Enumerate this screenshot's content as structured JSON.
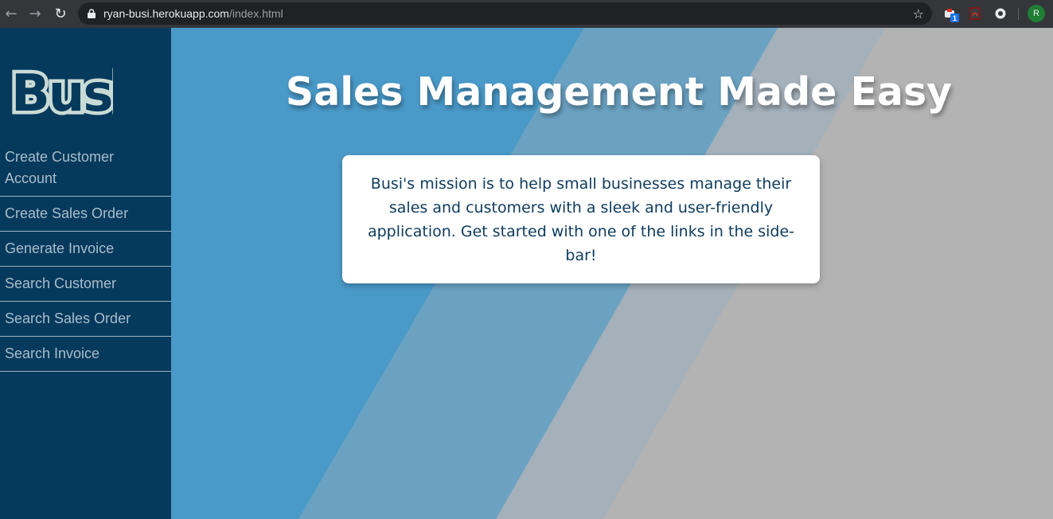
{
  "browser": {
    "url_host": "ryan-busi.herokuapp.com",
    "url_path": "/index.html",
    "profile_initial": "R",
    "extension_badge": "1"
  },
  "sidebar": {
    "logo_text": "Busi",
    "items": [
      {
        "label": "Create Customer Account"
      },
      {
        "label": "Create Sales Order"
      },
      {
        "label": "Generate Invoice"
      },
      {
        "label": "Search Customer"
      },
      {
        "label": "Search Sales Order"
      },
      {
        "label": "Search Invoice"
      }
    ]
  },
  "main": {
    "headline": "Sales Management Made Easy",
    "mission": "Busi's mission is to help small businesses manage their sales and customers with a sleek and user-friendly application. Get started with one of the links in the side-bar!"
  },
  "colors": {
    "sidebar_bg": "#063a5c",
    "stripe_blue": "#4a9ac9",
    "stripe_mid": "#6ba2c2",
    "stripe_light": "#a4b0ba",
    "stripe_gray": "#b3b3b3",
    "card_text": "#0d3b5e"
  }
}
